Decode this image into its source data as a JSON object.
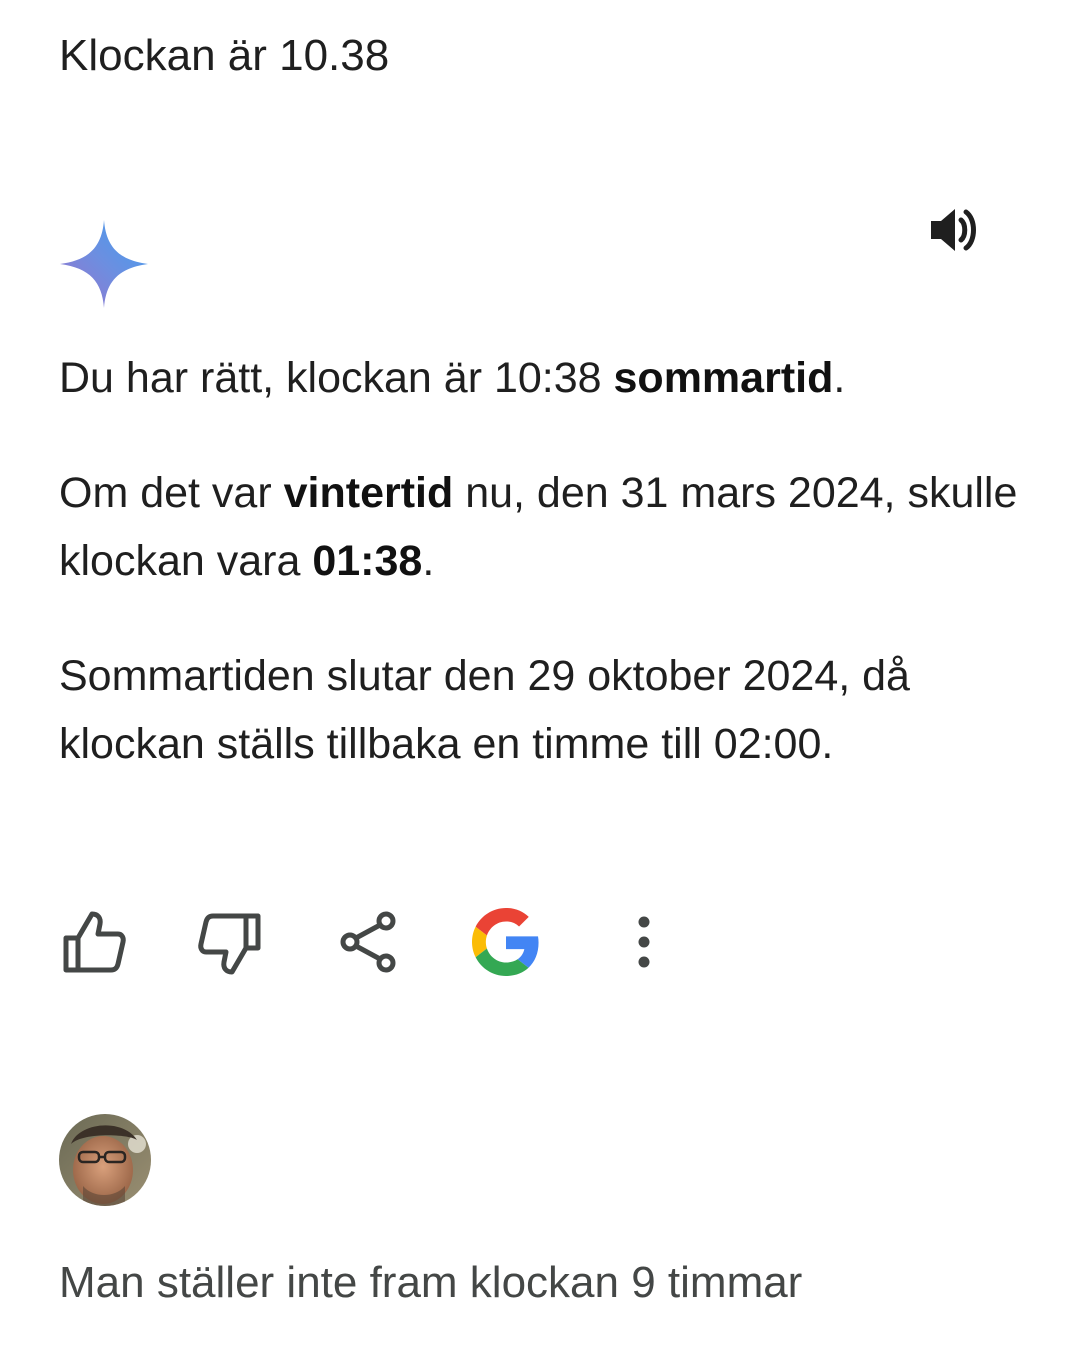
{
  "conversation": {
    "user_message": "Klockan är 10.38",
    "assistant": {
      "icon": "gemini-sparkle-icon",
      "speaker_icon": "speaker-volume-icon",
      "paragraph_1": {
        "text_1": "Du har rätt, klockan är 10:38 ",
        "bold_1": "sommartid",
        "text_2": "."
      },
      "paragraph_2": {
        "text_1": "Om det var ",
        "bold_1": "vintertid",
        "text_2": " nu, den 31 mars 2024, skulle klockan vara ",
        "bold_2": "01:38",
        "text_3": "."
      },
      "paragraph_3": {
        "text_1": "Sommartiden slutar den 29 oktober 2024, då klockan ställs tillbaka en timme till 02:00."
      },
      "actions": [
        {
          "icon": "thumbs-up-icon"
        },
        {
          "icon": "thumbs-down-icon"
        },
        {
          "icon": "share-icon"
        },
        {
          "icon": "google-g-icon"
        },
        {
          "icon": "more-vert-icon"
        }
      ]
    },
    "next_user": {
      "avatar": "user-avatar",
      "message": "Man ställer inte fram klockan 9 timmar"
    }
  },
  "colors": {
    "text": "#1f1f1f",
    "icon": "#444746",
    "google_blue": "#4285F4",
    "google_red": "#EA4335",
    "google_yellow": "#FBBC05",
    "google_green": "#34A853"
  }
}
